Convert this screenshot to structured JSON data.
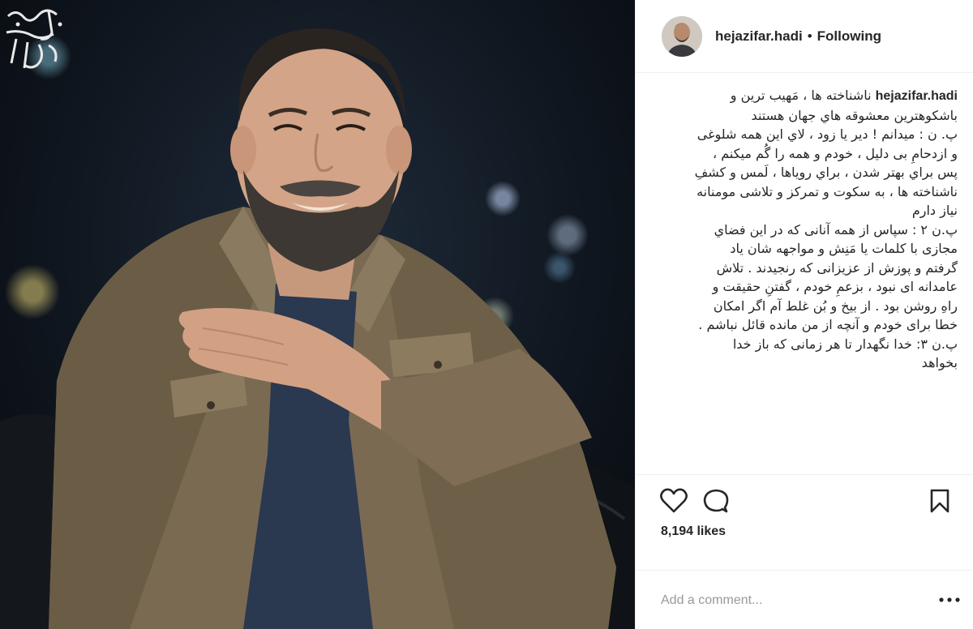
{
  "post": {
    "author": {
      "username": "hejazifar.hadi",
      "separator": "•",
      "follow_status": "Following"
    },
    "caption": {
      "username": "hejazifar.hadi",
      "lines": [
        "ناشناخته ها ، مَهیب ترین و",
        "باشکوهترین معشوقه هاي جهان هستند",
        "پ. ن : میدانم ! دیر یا زود ، لاي این همه شلوغی",
        "و ازدحامِ بی دلیل ، خودم و همه را گُم میکنم ،",
        "پس براي بهتر شدن ، براي رویاها ، لَمس و کشفِ",
        "ناشناخته ها ، به سکوت و تمرکز و تلاشی مومنانه",
        "نیاز دارم",
        "پ.ن ۲ : سپاس از همه آنانی که در این فضاي",
        "مجازی با کلمات یا مَنِش و مواجهه شان یاد",
        "گرفتم و پوزش از عزیزانی که رنجیدند . تلاش",
        "عامدانه ای نبود ، بزعمِ خودم ، گفتنِ حقیقت و",
        "راهِ روشن بود . از بیخ و بُن غلط آم اگر امکان",
        "خطا برای خودم و آنچه از من مانده قائل نباشم .",
        "پ.ن ۳: خدا نگهدار تا هر زمانی که باز خدا",
        "بخواهد"
      ]
    },
    "likes_text": "8,194 likes",
    "comment": {
      "placeholder": "Add a comment...",
      "more_label": "•••"
    },
    "icons": [
      "heart-icon",
      "comment-icon",
      "bookmark-icon",
      "more-icon"
    ],
    "colors": {
      "text": "#262626",
      "border": "#efefef",
      "placeholder": "#999999"
    }
  }
}
